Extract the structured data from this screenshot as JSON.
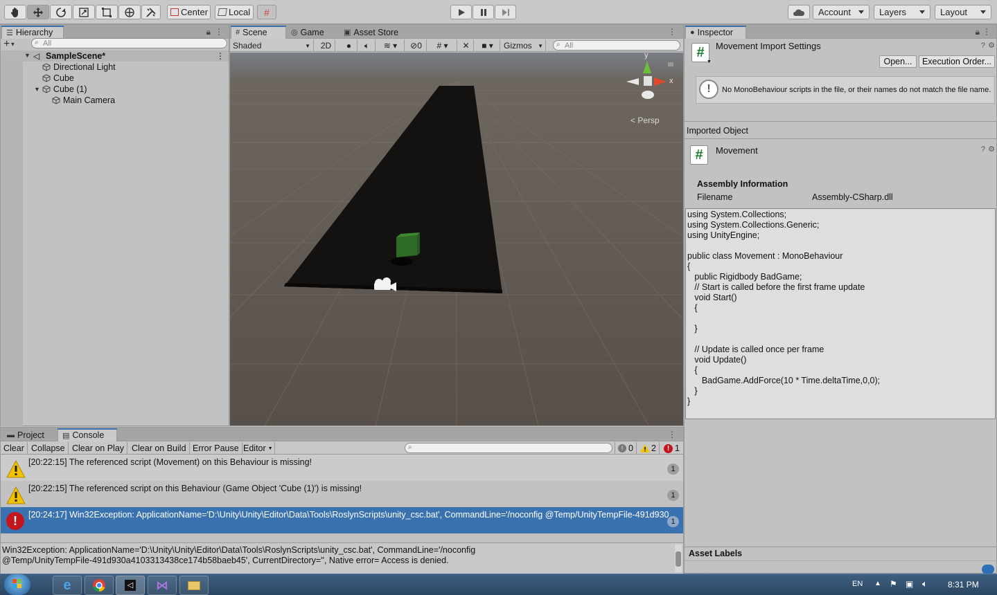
{
  "toolbar": {
    "center_label": "Center",
    "local_label": "Local",
    "account_label": "Account",
    "layers_label": "Layers",
    "layout_label": "Layout"
  },
  "hierarchy": {
    "tab_label": "Hierarchy",
    "search_placeholder": "All",
    "scene_name": "SampleScene*",
    "items": [
      {
        "label": "Directional Light"
      },
      {
        "label": "Cube"
      },
      {
        "label": "Cube (1)"
      },
      {
        "label": "Main Camera"
      }
    ]
  },
  "scene": {
    "tabs": [
      {
        "label": "Scene"
      },
      {
        "label": "Game"
      },
      {
        "label": "Asset Store"
      }
    ],
    "shading_mode": "Shaded",
    "mode_2d": "2D",
    "hidden_count": "0",
    "gizmos_label": "Gizmos",
    "search_placeholder": "All",
    "gizmo_y": "y",
    "gizmo_x": "x",
    "persp_label": "Persp"
  },
  "inspector": {
    "tab_label": "Inspector",
    "title": "Movement Import Settings",
    "open_button": "Open...",
    "exec_order_button": "Execution Order...",
    "warning_text": "No MonoBehaviour scripts in the file, or their names do not match the file name.",
    "imported_object_label": "Imported Object",
    "object_name": "Movement",
    "assembly_heading": "Assembly Information",
    "filename_label": "Filename",
    "filename_value": "Assembly-CSharp.dll",
    "code": "using System.Collections;\nusing System.Collections.Generic;\nusing UnityEngine;\n\npublic class Movement : MonoBehaviour\n{\n   public Rigidbody BadGame;\n   // Start is called before the first frame update\n   void Start()\n   {\n\n   }\n\n   // Update is called once per frame\n   void Update()\n   {\n      BadGame.AddForce(10 * Time.deltaTime,0,0);\n   }\n}",
    "asset_labels": "Asset Labels"
  },
  "console": {
    "tabs": [
      {
        "label": "Project"
      },
      {
        "label": "Console"
      }
    ],
    "buttons": {
      "clear": "Clear",
      "collapse": "Collapse",
      "clear_on_play": "Clear on Play",
      "clear_on_build": "Clear on Build",
      "error_pause": "Error Pause",
      "editor": "Editor"
    },
    "info_count": "0",
    "warning_count": "2",
    "error_count": "1",
    "entries": [
      {
        "type": "warning",
        "text": "[20:22:15] The referenced script (Movement) on this Behaviour is missing!",
        "count": "1"
      },
      {
        "type": "warning",
        "text": "[20:22:15] The referenced script on this Behaviour (Game Object 'Cube (1)') is missing!",
        "count": "1"
      },
      {
        "type": "error",
        "text": "[20:24:17] Win32Exception: ApplicationName='D:\\Unity\\Unity\\Editor\\Data\\Tools\\RoslynScripts\\unity_csc.bat', CommandLine='/noconfig @Temp/UnityTempFile-491d930",
        "count": "1"
      }
    ],
    "detail_line1": "Win32Exception: ApplicationName='D:\\Unity\\Unity\\Editor\\Data\\Tools\\RoslynScripts\\unity_csc.bat', CommandLine='/noconfig",
    "detail_line2": "@Temp/UnityTempFile-491d930a4103313438ce174b58baeb45', CurrentDirectory='', Native error= Access is denied."
  },
  "taskbar": {
    "lang": "EN",
    "time": "8:31 PM"
  },
  "colors": {
    "selection_blue": "#3a72b0",
    "error_red": "#c4161c",
    "warning_yellow": "#f2c200",
    "script_green": "#1a7a2e"
  }
}
